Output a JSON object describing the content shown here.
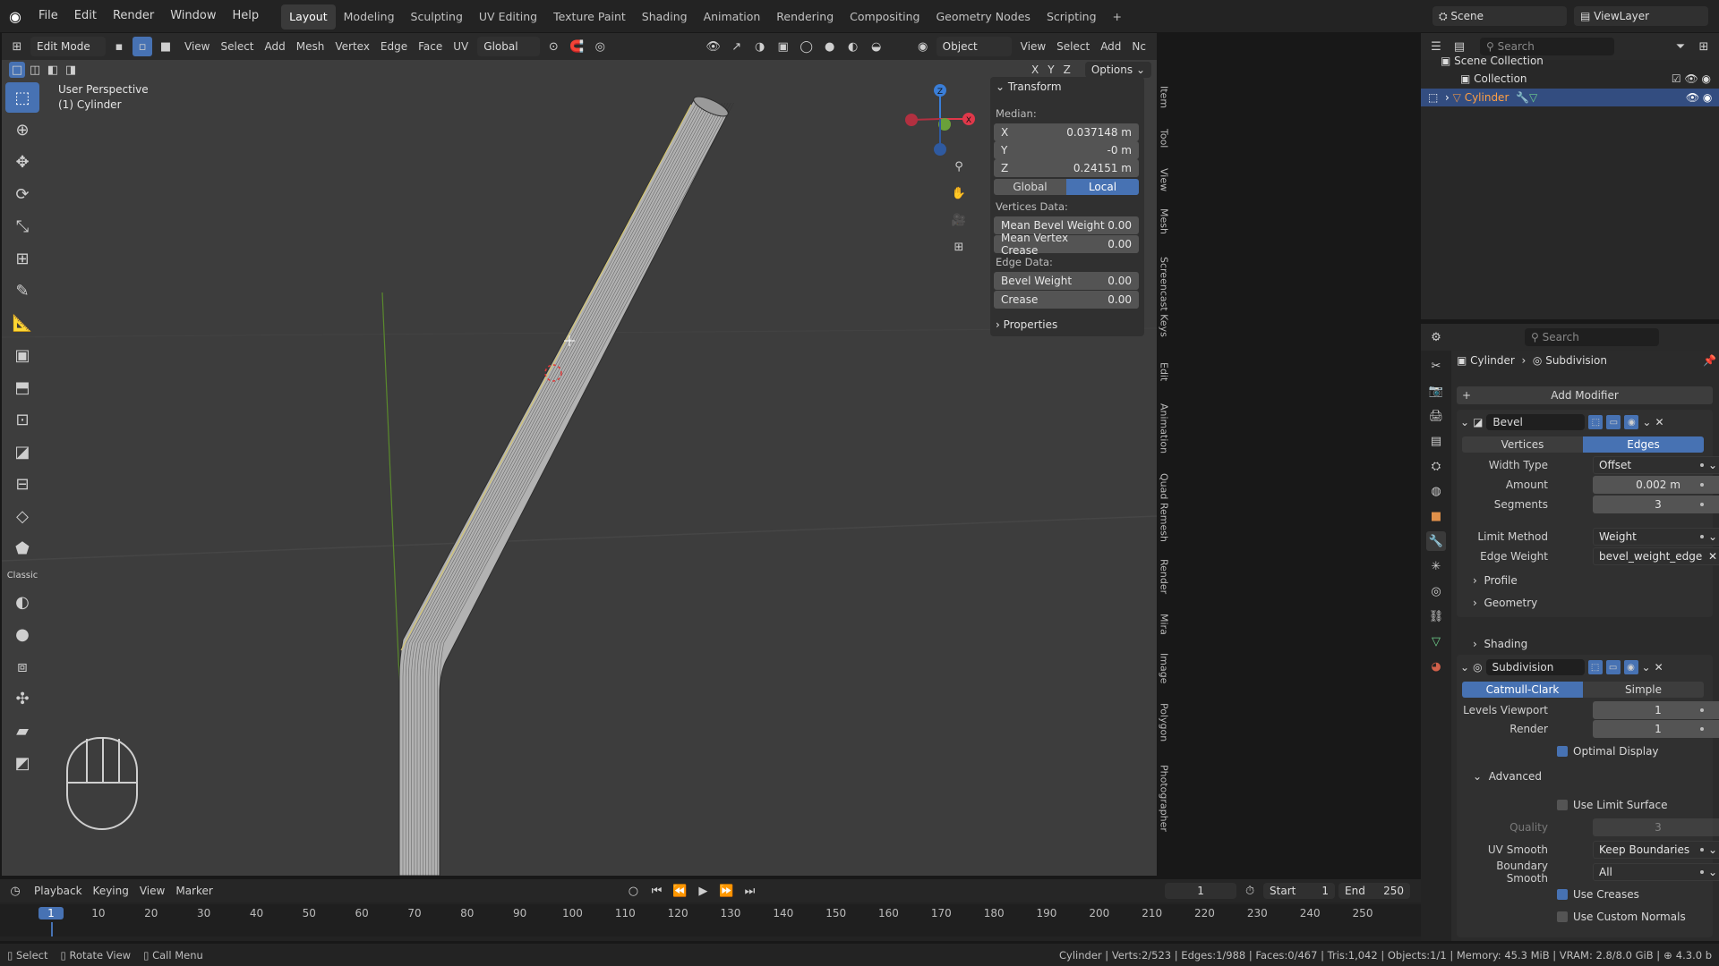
{
  "app": {
    "menus": [
      "File",
      "Edit",
      "Render",
      "Window",
      "Help"
    ],
    "workspaces": [
      "Layout",
      "Modeling",
      "Sculpting",
      "UV Editing",
      "Texture Paint",
      "Shading",
      "Animation",
      "Rendering",
      "Compositing",
      "Geometry Nodes",
      "Scripting"
    ],
    "active_workspace": "Layout",
    "add_tab": "+",
    "scene_label": "Scene",
    "viewlayer_label": "ViewLayer"
  },
  "viewport_header": {
    "mode": "Edit Mode",
    "menus": [
      "View",
      "Select",
      "Add",
      "Mesh",
      "Vertex",
      "Edge",
      "Face",
      "UV"
    ],
    "orientation": "Global",
    "object_label": "Object",
    "right_menus": [
      "View",
      "Select",
      "Add",
      "Nc"
    ],
    "options_label": "Options",
    "axis_x": "X",
    "axis_y": "Y",
    "axis_z": "Z"
  },
  "viewport": {
    "perspective_label": "User Perspective",
    "object_label": "(1) Cylinder",
    "colors": {
      "background": "#3d3d3d",
      "grid": "#464646",
      "y_axis": "#5a8a2c",
      "mesh": "#b8b8b8",
      "mesh_wire": "#2e2e2e"
    }
  },
  "tools": [
    {
      "name": "select-box-icon",
      "glyph": "⬚",
      "active": true
    },
    {
      "name": "cursor-icon",
      "glyph": "⊕"
    },
    {
      "name": "move-icon",
      "glyph": "✥"
    },
    {
      "name": "rotate-icon",
      "glyph": "⟳"
    },
    {
      "name": "scale-icon",
      "glyph": "⤡"
    },
    {
      "name": "transform-icon",
      "glyph": "⊞"
    },
    {
      "name": "annotate-icon",
      "glyph": "✎"
    },
    {
      "name": "measure-icon",
      "glyph": "📐"
    },
    {
      "name": "add-cube-icon",
      "glyph": "▣"
    },
    {
      "name": "extrude-icon",
      "glyph": "⬒"
    },
    {
      "name": "inset-icon",
      "glyph": "⊡"
    },
    {
      "name": "bevel-icon",
      "glyph": "◪"
    },
    {
      "name": "loop-cut-icon",
      "glyph": "⊟"
    },
    {
      "name": "knife-icon",
      "glyph": "◇"
    },
    {
      "name": "poly-build-icon",
      "glyph": "⬟"
    },
    {
      "name": "classic-label",
      "glyph": "Classic"
    },
    {
      "name": "spin-icon",
      "glyph": "◐"
    },
    {
      "name": "smooth-icon",
      "glyph": "●"
    },
    {
      "name": "edge-slide-icon",
      "glyph": "⧈"
    },
    {
      "name": "shrink-icon",
      "glyph": "✣"
    },
    {
      "name": "shear-icon",
      "glyph": "▰"
    },
    {
      "name": "rip-icon",
      "glyph": "◩"
    }
  ],
  "npanel": {
    "section": "Transform",
    "median_label": "Median:",
    "x_label": "X",
    "x_value": "0.037148 m",
    "y_label": "Y",
    "y_value": "-0 m",
    "z_label": "Z",
    "z_value": "0.24151 m",
    "global_label": "Global",
    "local_label": "Local",
    "vertices_data_label": "Vertices Data:",
    "mean_bevel_label": "Mean Bevel Weight",
    "mean_bevel_value": "0.00",
    "mean_crease_label": "Mean Vertex Crease",
    "mean_crease_value": "0.00",
    "edge_data_label": "Edge Data:",
    "bevel_weight_label": "Bevel Weight",
    "bevel_weight_value": "0.00",
    "crease_label": "Crease",
    "crease_value": "0.00",
    "properties_label": "Properties"
  },
  "vertical_tabs": [
    "Item",
    "Tool",
    "View",
    "Mesh",
    "Screencast Keys",
    "Edit",
    "Animation",
    "Quad Remesh",
    "Render",
    "Mira",
    "Image",
    "Polygon",
    "Photographer"
  ],
  "outliner": {
    "search_placeholder": "Search",
    "scene_collection": "Scene Collection",
    "collection": "Collection",
    "cylinder": "Cylinder"
  },
  "properties": {
    "search_placeholder": "Search",
    "breadcrumb_object": "Cylinder",
    "breadcrumb_modifier": "Subdivision",
    "add_modifier": "Add Modifier",
    "bevel": {
      "name": "Bevel",
      "vertices_tab": "Vertices",
      "edges_tab": "Edges",
      "width_type_label": "Width Type",
      "width_type_value": "Offset",
      "amount_label": "Amount",
      "amount_value": "0.002 m",
      "segments_label": "Segments",
      "segments_value": "3",
      "limit_method_label": "Limit Method",
      "limit_method_value": "Weight",
      "edge_weight_label": "Edge Weight",
      "edge_weight_value": "bevel_weight_edge",
      "profile_label": "Profile",
      "geometry_label": "Geometry",
      "shading_label": "Shading"
    },
    "subdivision": {
      "name": "Subdivision",
      "catmull_tab": "Catmull-Clark",
      "simple_tab": "Simple",
      "levels_viewport_label": "Levels Viewport",
      "levels_viewport_value": "1",
      "render_label": "Render",
      "render_value": "1",
      "optimal_display_label": "Optimal Display",
      "advanced_label": "Advanced",
      "use_limit_surface_label": "Use Limit Surface",
      "quality_label": "Quality",
      "quality_value": "3",
      "uv_smooth_label": "UV Smooth",
      "uv_smooth_value": "Keep Boundaries",
      "boundary_smooth_label": "Boundary Smooth",
      "boundary_smooth_value": "All",
      "use_creases_label": "Use Creases",
      "use_custom_normals_label": "Use Custom Normals"
    }
  },
  "timeline": {
    "menus": [
      "Playback",
      "Keying",
      "View",
      "Marker"
    ],
    "current_frame": "1",
    "start_label": "Start",
    "start_value": "1",
    "end_label": "End",
    "end_value": "250",
    "ticks": [
      "1",
      "10",
      "20",
      "30",
      "40",
      "50",
      "60",
      "70",
      "80",
      "90",
      "100",
      "110",
      "120",
      "130",
      "140",
      "150",
      "160",
      "170",
      "180",
      "190",
      "200",
      "210",
      "220",
      "230",
      "240",
      "250"
    ]
  },
  "statusbar": {
    "select": "Select",
    "rotate_view": "Rotate View",
    "call_menu": "Call Menu",
    "stats": "Cylinder | Verts:2/523 | Edges:1/988 | Faces:0/467 | Tris:1,042 | Objects:1/1 | Memory: 45.3 MiB | VRAM: 2.8/8.0 GiB |",
    "version": "4.3.0 b"
  }
}
